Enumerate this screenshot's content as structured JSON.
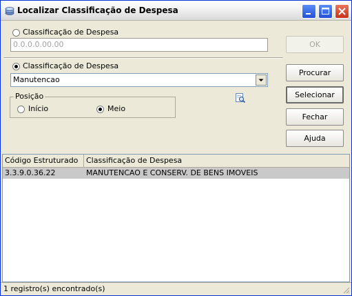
{
  "window": {
    "title": "Localizar Classificação de Despesa",
    "icon": "stack-layers-icon",
    "controls": [
      "minimize",
      "maximize",
      "close"
    ]
  },
  "search_by_code": {
    "radio_label": "Classificação de Despesa",
    "selected": false,
    "code_value": "0.0.0.0.00.00",
    "ok_label": "OK"
  },
  "search_by_description": {
    "radio_label": "Classificação de Despesa",
    "selected": true,
    "combo_value": "Manutencao"
  },
  "position": {
    "legend": "Posição",
    "options": [
      {
        "label": "Início",
        "selected": false
      },
      {
        "label": "Meio",
        "selected": true
      }
    ],
    "search_icon": "search-document-icon"
  },
  "buttons": {
    "procurar": "Procurar",
    "selecionar": "Selecionar",
    "fechar": "Fechar",
    "ajuda": "Ajuda"
  },
  "results": {
    "columns": [
      "Código Estruturado",
      "Classificação de Despesa"
    ],
    "rows": [
      [
        "3.3.9.0.36.22",
        "MANUTENCAO E CONSERV. DE BENS IMOVEIS"
      ]
    ]
  },
  "status": {
    "text": "1 registro(s) encontrado(s)"
  }
}
